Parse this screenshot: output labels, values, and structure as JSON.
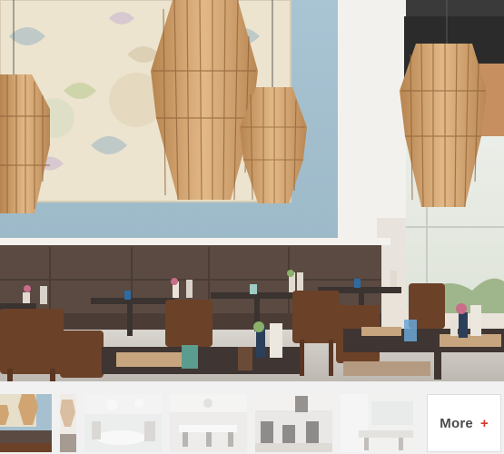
{
  "gallery": {
    "more_label": "More",
    "more_icon": "plus-icon",
    "accent_color": "#d9372b",
    "thumbnails": [
      {
        "state": "active"
      },
      {
        "state": "dim"
      },
      {
        "state": "dim"
      },
      {
        "state": "dim"
      },
      {
        "state": "dim"
      },
      {
        "state": "dim"
      }
    ]
  }
}
